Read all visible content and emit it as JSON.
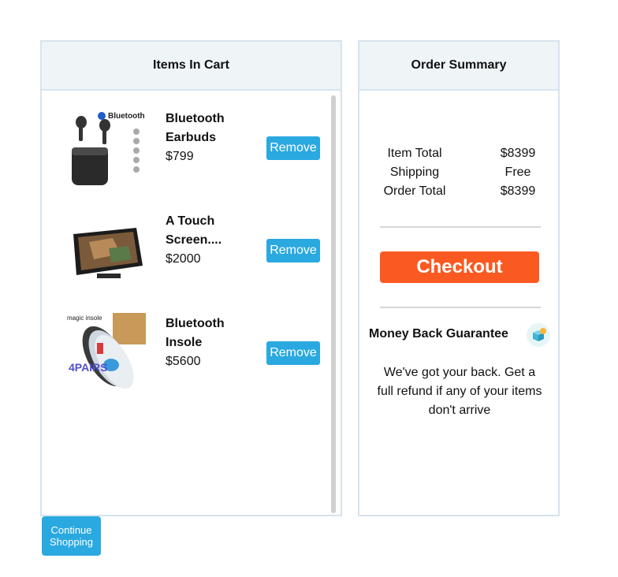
{
  "cart": {
    "header": "Items In Cart",
    "items": [
      {
        "name": "Bluetooth Earbuds",
        "price": "$799",
        "remove_label": "Remove",
        "image_text": "Bluetooth"
      },
      {
        "name": "A Touch Screen....",
        "price": "$2000",
        "remove_label": "Remove"
      },
      {
        "name": "Bluetooth Insole",
        "price": "$5600",
        "remove_label": "Remove",
        "image_text": "magic insole",
        "image_badge": "4PAIRS"
      }
    ]
  },
  "summary": {
    "header": "Order Summary",
    "rows": [
      {
        "label": "Item Total",
        "value": "$8399"
      },
      {
        "label": "Shipping",
        "value": "Free"
      },
      {
        "label": "Order Total",
        "value": "$8399"
      }
    ],
    "checkout_label": "Checkout",
    "guarantee_title": "Money Back Guarantee",
    "guarantee_text": "We've got your back. Get a full refund if any of your items don't arrive"
  },
  "continue_label": "Continue Shopping",
  "colors": {
    "accent_blue": "#2aa9e0",
    "checkout_orange": "#fa5a21",
    "header_bg": "#eff4f7",
    "border": "#d7e3ee"
  }
}
